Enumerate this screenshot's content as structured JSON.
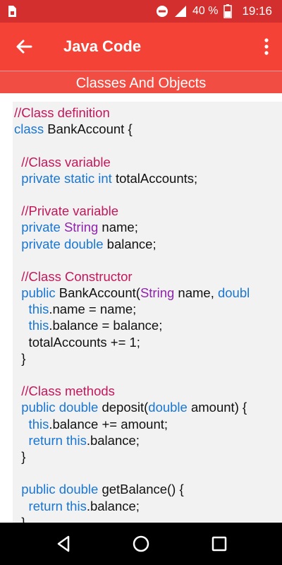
{
  "status_bar": {
    "battery_percent": "40 %",
    "time": "19:16"
  },
  "app_bar": {
    "title": "Java Code"
  },
  "section": {
    "title": "Classes And Objects"
  },
  "colors": {
    "status_bar": "#d32f2f",
    "app_bar": "#f44336",
    "comment": "#c2185b",
    "keyword": "#1976d2",
    "type": "#8e24aa"
  },
  "code_lines": [
    [
      {
        "t": "//Class definition",
        "c": "comment"
      }
    ],
    [
      {
        "t": "class",
        "c": "kw"
      },
      {
        "t": " BankAccount {",
        "c": "plain"
      }
    ],
    [],
    [
      {
        "t": "  //Class variable",
        "c": "comment"
      }
    ],
    [
      {
        "t": "  private static int",
        "c": "kw"
      },
      {
        "t": " totalAccounts;",
        "c": "plain"
      }
    ],
    [],
    [
      {
        "t": "  //Private variable",
        "c": "comment"
      }
    ],
    [
      {
        "t": "  private",
        "c": "kw"
      },
      {
        "t": " ",
        "c": "plain"
      },
      {
        "t": "String",
        "c": "type"
      },
      {
        "t": " name;",
        "c": "plain"
      }
    ],
    [
      {
        "t": "  private double",
        "c": "kw"
      },
      {
        "t": " balance;",
        "c": "plain"
      }
    ],
    [],
    [
      {
        "t": "  //Class Constructor",
        "c": "comment"
      }
    ],
    [
      {
        "t": "  public",
        "c": "kw"
      },
      {
        "t": " BankAccount(",
        "c": "plain"
      },
      {
        "t": "String",
        "c": "type"
      },
      {
        "t": " name, ",
        "c": "plain"
      },
      {
        "t": "doubl",
        "c": "kw"
      }
    ],
    [
      {
        "t": "    this",
        "c": "kw"
      },
      {
        "t": ".name = name;",
        "c": "plain"
      }
    ],
    [
      {
        "t": "    this",
        "c": "kw"
      },
      {
        "t": ".balance = balance;",
        "c": "plain"
      }
    ],
    [
      {
        "t": "    totalAccounts += 1;",
        "c": "plain"
      }
    ],
    [
      {
        "t": "  }",
        "c": "plain"
      }
    ],
    [],
    [
      {
        "t": "  //Class methods",
        "c": "comment"
      }
    ],
    [
      {
        "t": "  public double",
        "c": "kw"
      },
      {
        "t": " deposit(",
        "c": "plain"
      },
      {
        "t": "double",
        "c": "kw"
      },
      {
        "t": " amount) {",
        "c": "plain"
      }
    ],
    [
      {
        "t": "    this",
        "c": "kw"
      },
      {
        "t": ".balance += amount;",
        "c": "plain"
      }
    ],
    [
      {
        "t": "    return this",
        "c": "kw"
      },
      {
        "t": ".balance;",
        "c": "plain"
      }
    ],
    [
      {
        "t": "  }",
        "c": "plain"
      }
    ],
    [],
    [
      {
        "t": "  public double",
        "c": "kw"
      },
      {
        "t": " getBalance() {",
        "c": "plain"
      }
    ],
    [
      {
        "t": "    return this",
        "c": "kw"
      },
      {
        "t": ".balance;",
        "c": "plain"
      }
    ],
    [
      {
        "t": "  }",
        "c": "plain"
      }
    ]
  ]
}
